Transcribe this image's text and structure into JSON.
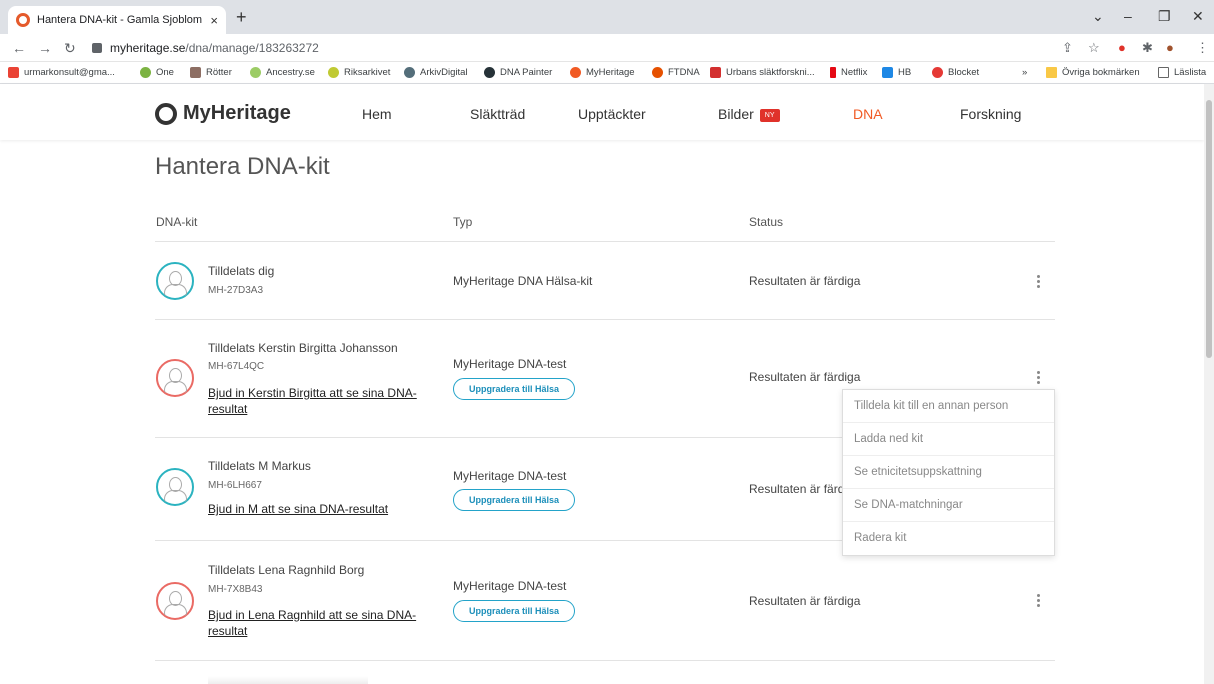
{
  "browser": {
    "tab_title": "Hantera DNA-kit - Gamla Sjoblom",
    "tab_close": "×",
    "new_tab": "+",
    "url_host": "myheritage.se",
    "url_path": "/dna/manage/183263272",
    "bookmarks": [
      "urmarkonsult@gma...",
      "One",
      "Rötter",
      "Ancestry.se",
      "Riksarkivet",
      "ArkivDigital",
      "DNA Painter",
      "MyHeritage",
      "FTDNA",
      "Urbans släktforskni...",
      "Netflix",
      "HB",
      "Blocket"
    ],
    "bookmarks_more": "»",
    "other_bookmarks": "Övriga bokmärken",
    "reading_list": "Läslista"
  },
  "site": {
    "logo": "MyHeritage",
    "nav": [
      "Hem",
      "Släktträd",
      "Upptäckter",
      "Bilder",
      "DNA",
      "Forskning"
    ],
    "new_badge": "NY"
  },
  "page": {
    "title": "Hantera DNA-kit",
    "columns": [
      "DNA-kit",
      "Typ",
      "Status"
    ]
  },
  "kits": [
    {
      "name": "Tilldelats dig",
      "id": "MH-27D3A3",
      "type": "MyHeritage DNA Hälsa-kit",
      "status": "Resultaten är färdiga",
      "gender": "m"
    },
    {
      "name": "Tilldelats Kerstin Birgitta Johansson",
      "id": "MH-67L4QC",
      "invite": "Bjud in Kerstin Birgitta att se sina DNA-resultat",
      "type": "MyHeritage DNA-test",
      "upgrade": "Uppgradera till Hälsa",
      "status": "Resultaten är färdiga",
      "gender": "f"
    },
    {
      "name": "Tilldelats M Markus",
      "id": "MH-6LH667",
      "invite": "Bjud in M att se sina DNA-resultat",
      "type": "MyHeritage DNA-test",
      "upgrade": "Uppgradera till Hälsa",
      "status": "Resultaten är färdiga",
      "gender": "m"
    },
    {
      "name": "Tilldelats Lena Ragnhild Borg",
      "id": "MH-7X8B43",
      "invite": "Bjud in Lena Ragnhild att se sina DNA-resultat",
      "type": "MyHeritage DNA-test",
      "upgrade": "Uppgradera till Hälsa",
      "status": "Resultaten är färdiga",
      "gender": "f"
    }
  ],
  "menu": [
    "Tilldela kit till en annan person",
    "Ladda ned kit",
    "Se etnicitetsuppskattning",
    "Se DNA-matchningar",
    "Radera kit"
  ],
  "colors": {
    "accent": "#f15a24",
    "link_blue": "#1c8fba",
    "male": "#2bb3c0",
    "female": "#ea6a64"
  }
}
